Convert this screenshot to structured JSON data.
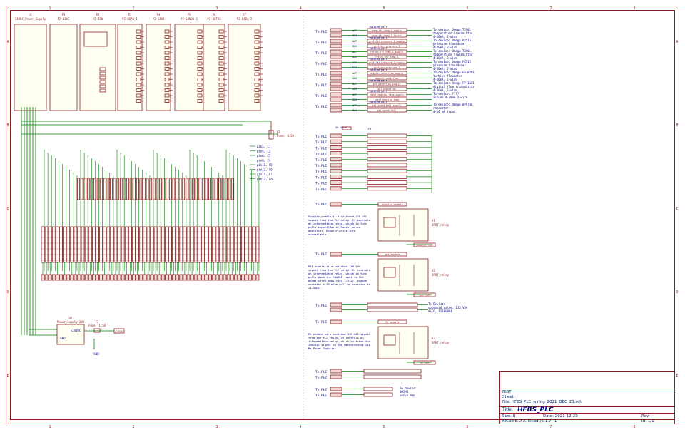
{
  "modules": [
    {
      "ref": "U1",
      "name": "24VDC_Power_Supply"
    },
    {
      "ref": "P1",
      "name": "P2-01AC"
    },
    {
      "ref": "P2",
      "name": "P2-550"
    },
    {
      "ref": "P3",
      "name": "P2-08AD-1"
    },
    {
      "ref": "P4",
      "name": "P2-04AD"
    },
    {
      "ref": "P5",
      "name": "P2-08ND3-1"
    },
    {
      "ref": "P6",
      "name": "P2-08TRS"
    },
    {
      "ref": "P7",
      "name": "P2-04DA-2"
    }
  ],
  "plc_left": [
    {
      "label": "To PLC",
      "a": "2+Hz (P3)",
      "b": "(P3-1)",
      "pair": "twisted pair",
      "w1": "WHT",
      "w2": "BLK",
      "n1": "pump_ctr_temp_1_supply",
      "n2": "pump_ctr_temp_1_signal"
    },
    {
      "label": "To PLC",
      "a": "2+Hz (P3)",
      "b": "(P3-2)",
      "pair": "twisted pair",
      "w1": "WHT",
      "w2": "BLK",
      "n1": "profiler_pressure_1_supply",
      "n2": "profiler_pressure_1"
    },
    {
      "label": "To PLC",
      "a": "2+Hz (P3)",
      "b": "(P3-3)",
      "pair": "twisted pair",
      "w1": "WHT",
      "w2": "BLK",
      "n1": "return_ctr_temp_2_supply",
      "n2": "return_ctr_temp_2"
    },
    {
      "label": "To PLC",
      "a": "2+Hz (P3)",
      "b": "(P3-4)",
      "pair": "twisted pair",
      "w1": "WHT",
      "w2": "BLK",
      "n1": "profiler_pressure_2_supply",
      "n2": "profiler_pressure_2"
    },
    {
      "label": "To PLC",
      "a": "2+Hz (P3)",
      "b": "(P3-5)",
      "pair": "twisted pair",
      "w1": "WHT",
      "w2": "BLK",
      "n1": "doppler_waterflow_supply",
      "n2": "doppler_waterflow"
    },
    {
      "label": "To PLC",
      "a": "2+Hz (P3)",
      "b": "(P3-6)",
      "pair": "twisted pair",
      "w1": "WHT",
      "w2": "BLK",
      "n1": "pol_waterflow_supply",
      "n2": "pol_waterflow"
    },
    {
      "label": "To PLC",
      "a": "2+Hz (P3)",
      "b": "(P3-7)",
      "pair": "twisted pair",
      "w1": "WHT",
      "w2": "BLK",
      "n1": "staff_heating_temp_supply",
      "n2": "staff_heating_temp"
    },
    {
      "label": "To PLC",
      "a": "2+Hz (P3)",
      "b": "(P3-8)",
      "pair": "twisted pair",
      "w1": "WHT",
      "w2": "BLK",
      "n1": "pol_speed_Hall_supply",
      "n2": "pol_speed_Hall"
    }
  ],
  "devices_top": [
    {
      "l1": "To device: Omega TX90L",
      "l2": "temperature transmitter",
      "l3": "4-20mA, 2-wire"
    },
    {
      "l1": "To device: Omega PX515",
      "l2": "pressure transducer",
      "l3": "4-20mA, 2-wire"
    },
    {
      "l1": "To device: Omega TX90L",
      "l2": "temperature transmitter",
      "l3": "4-20mA, 2-wire"
    },
    {
      "l1": "To device: Omega PX515",
      "l2": "pressure transducer",
      "l3": "4-20mA, 2-wire"
    },
    {
      "l1": "To device: Omega FP-8791",
      "l2": "turbine flowmeter",
      "l3": "4-20mA, 2-wire"
    },
    {
      "l1": "To device: Omega FP-1521",
      "l2": "digital flow transmitter",
      "l3": "4-20mA, 2-wire"
    },
    {
      "l1": "To device: ?????",
      "l2": "assume 4-20mA 2-wire",
      "l3": ""
    },
    {
      "l1": "To device: Omega DPF700",
      "l2": "ratemeter",
      "l3": "4-20 mA input"
    }
  ],
  "fuse_f1": {
    "ref": "F1",
    "value": "Fuse, 0.5A"
  },
  "fuse_f2": {
    "ref": "F2",
    "value": "Fuse, 1.5A"
  },
  "resistor": {
    "ref": "R1",
    "value": "2k 10mm"
  },
  "pins": [
    "pin2, C1",
    "pin4, C2",
    "pin6, C3",
    "pin8, C4",
    "pin11, C5",
    "pin13, C6",
    "pin15, C7",
    "pin17, C8"
  ],
  "relays": [
    {
      "ref": "K1",
      "type": "DPDT_relay",
      "note": "Doppler_enable is a switched 120 VAC signal from the PLC relay. It controls an intermediate relay, which in turn pulls input1/Master/Modes* servo amplifier. Doppler Drive info unavailable",
      "in": "doppler_enable",
      "out": "doppler_COM"
    },
    {
      "ref": "K2",
      "type": "DPDT_relay",
      "note": "PSI enable is a switched 110 VAC signal from the PLC relay. It controls an intermediate relay, which in turn pulls down the ENABLE input to the 805M4 servo amplifier (J1-2). Enable contains a 20 kOhm pull-up resistor to +4.5VDC.",
      "in": "psi_enable",
      "out": "psi_COM"
    },
    {
      "ref": "K3",
      "type": "DPDT_relay",
      "note": "Mr enable is a switched 110 VAC signal from the PLC relay. It controls an intermediate relay, which switches the INHIBIT signal on the Mechatronics 258 Mr Power Supplies",
      "in": "Mr_enable",
      "out": "hv_COM"
    }
  ],
  "power2": {
    "ref": "U2",
    "name": "Power_Supply_24V",
    "net": "+24VDC",
    "gnd": "GND"
  },
  "solenoid": {
    "l1": "To Device:",
    "l2": "solenoid valve, 115 VAC",
    "l3": "ASCO, 8210G094"
  },
  "amp": {
    "l1": "To device:",
    "l2": "805M4",
    "l3": "servo amp"
  },
  "title_block": {
    "org": "NIST",
    "sheet": "Sheet: /",
    "file": "File: HFBS_PLC_wiring_2021_DEC_23.sch",
    "title_label": "Title:",
    "title": "HFBS_PLC",
    "size": "Size: B",
    "date": "Date: 2021-12-23",
    "rev": "Rev: --",
    "kicad": "KiCad E.D.A.  kicad (5.1.7)-1",
    "id": "Id: 1/1"
  },
  "zones_top": [
    "1",
    "2",
    "3",
    "4",
    "5",
    "6",
    "7",
    "8"
  ],
  "zones_side": [
    "A",
    "B",
    "C",
    "D",
    "E"
  ],
  "colors": {
    "wire": "#008000",
    "part": "#8a2020",
    "text": "#000080",
    "net": "#8a2020"
  }
}
